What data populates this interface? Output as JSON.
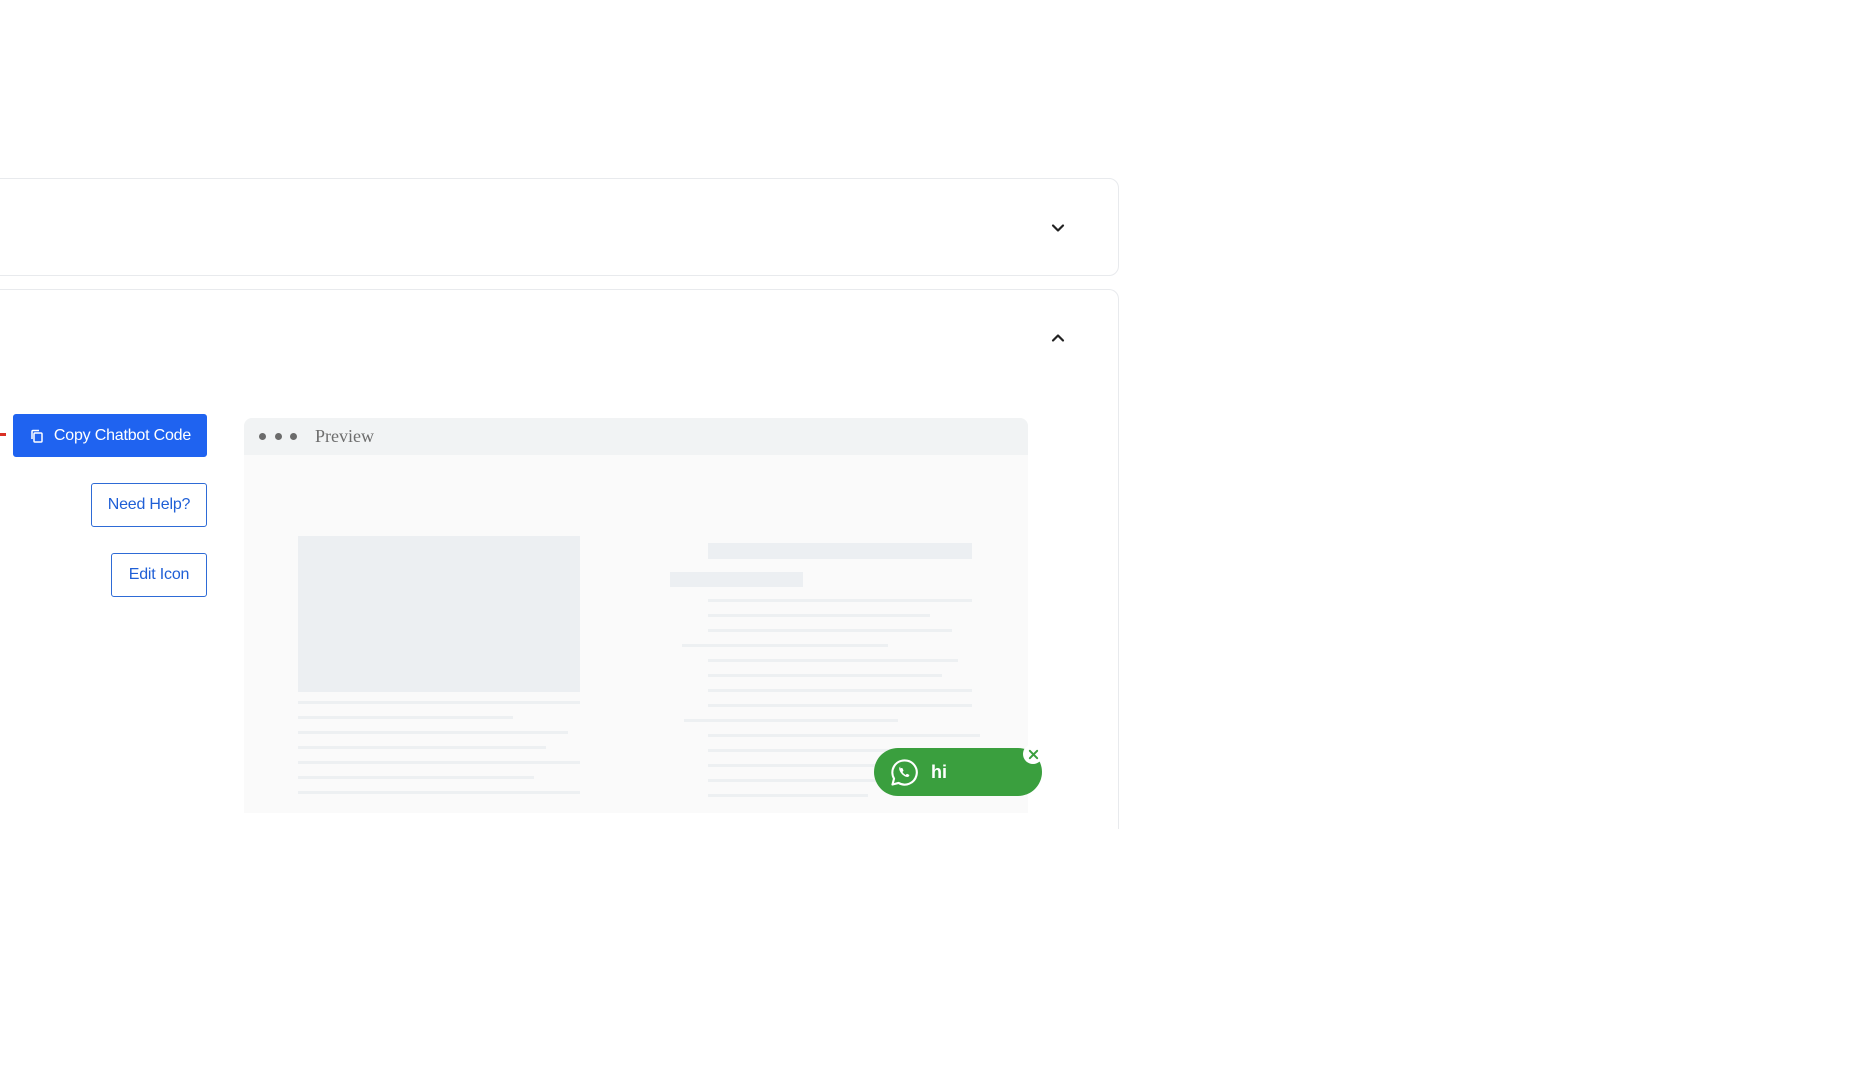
{
  "buttons": {
    "copy_code": "Copy Chatbot Code",
    "need_help": "Need Help?",
    "edit_icon": "Edit Icon"
  },
  "preview": {
    "label": "Preview"
  },
  "chat_widget": {
    "text": "hi",
    "icon": "whatsapp-icon",
    "close_icon": "close-icon"
  },
  "colors": {
    "primary": "#1f63f0",
    "whatsapp_green": "#3a9f3e"
  },
  "icons": {
    "collapsed_panel": "chevron-down-icon",
    "expanded_panel": "chevron-up-icon",
    "copy": "copy-icon"
  }
}
